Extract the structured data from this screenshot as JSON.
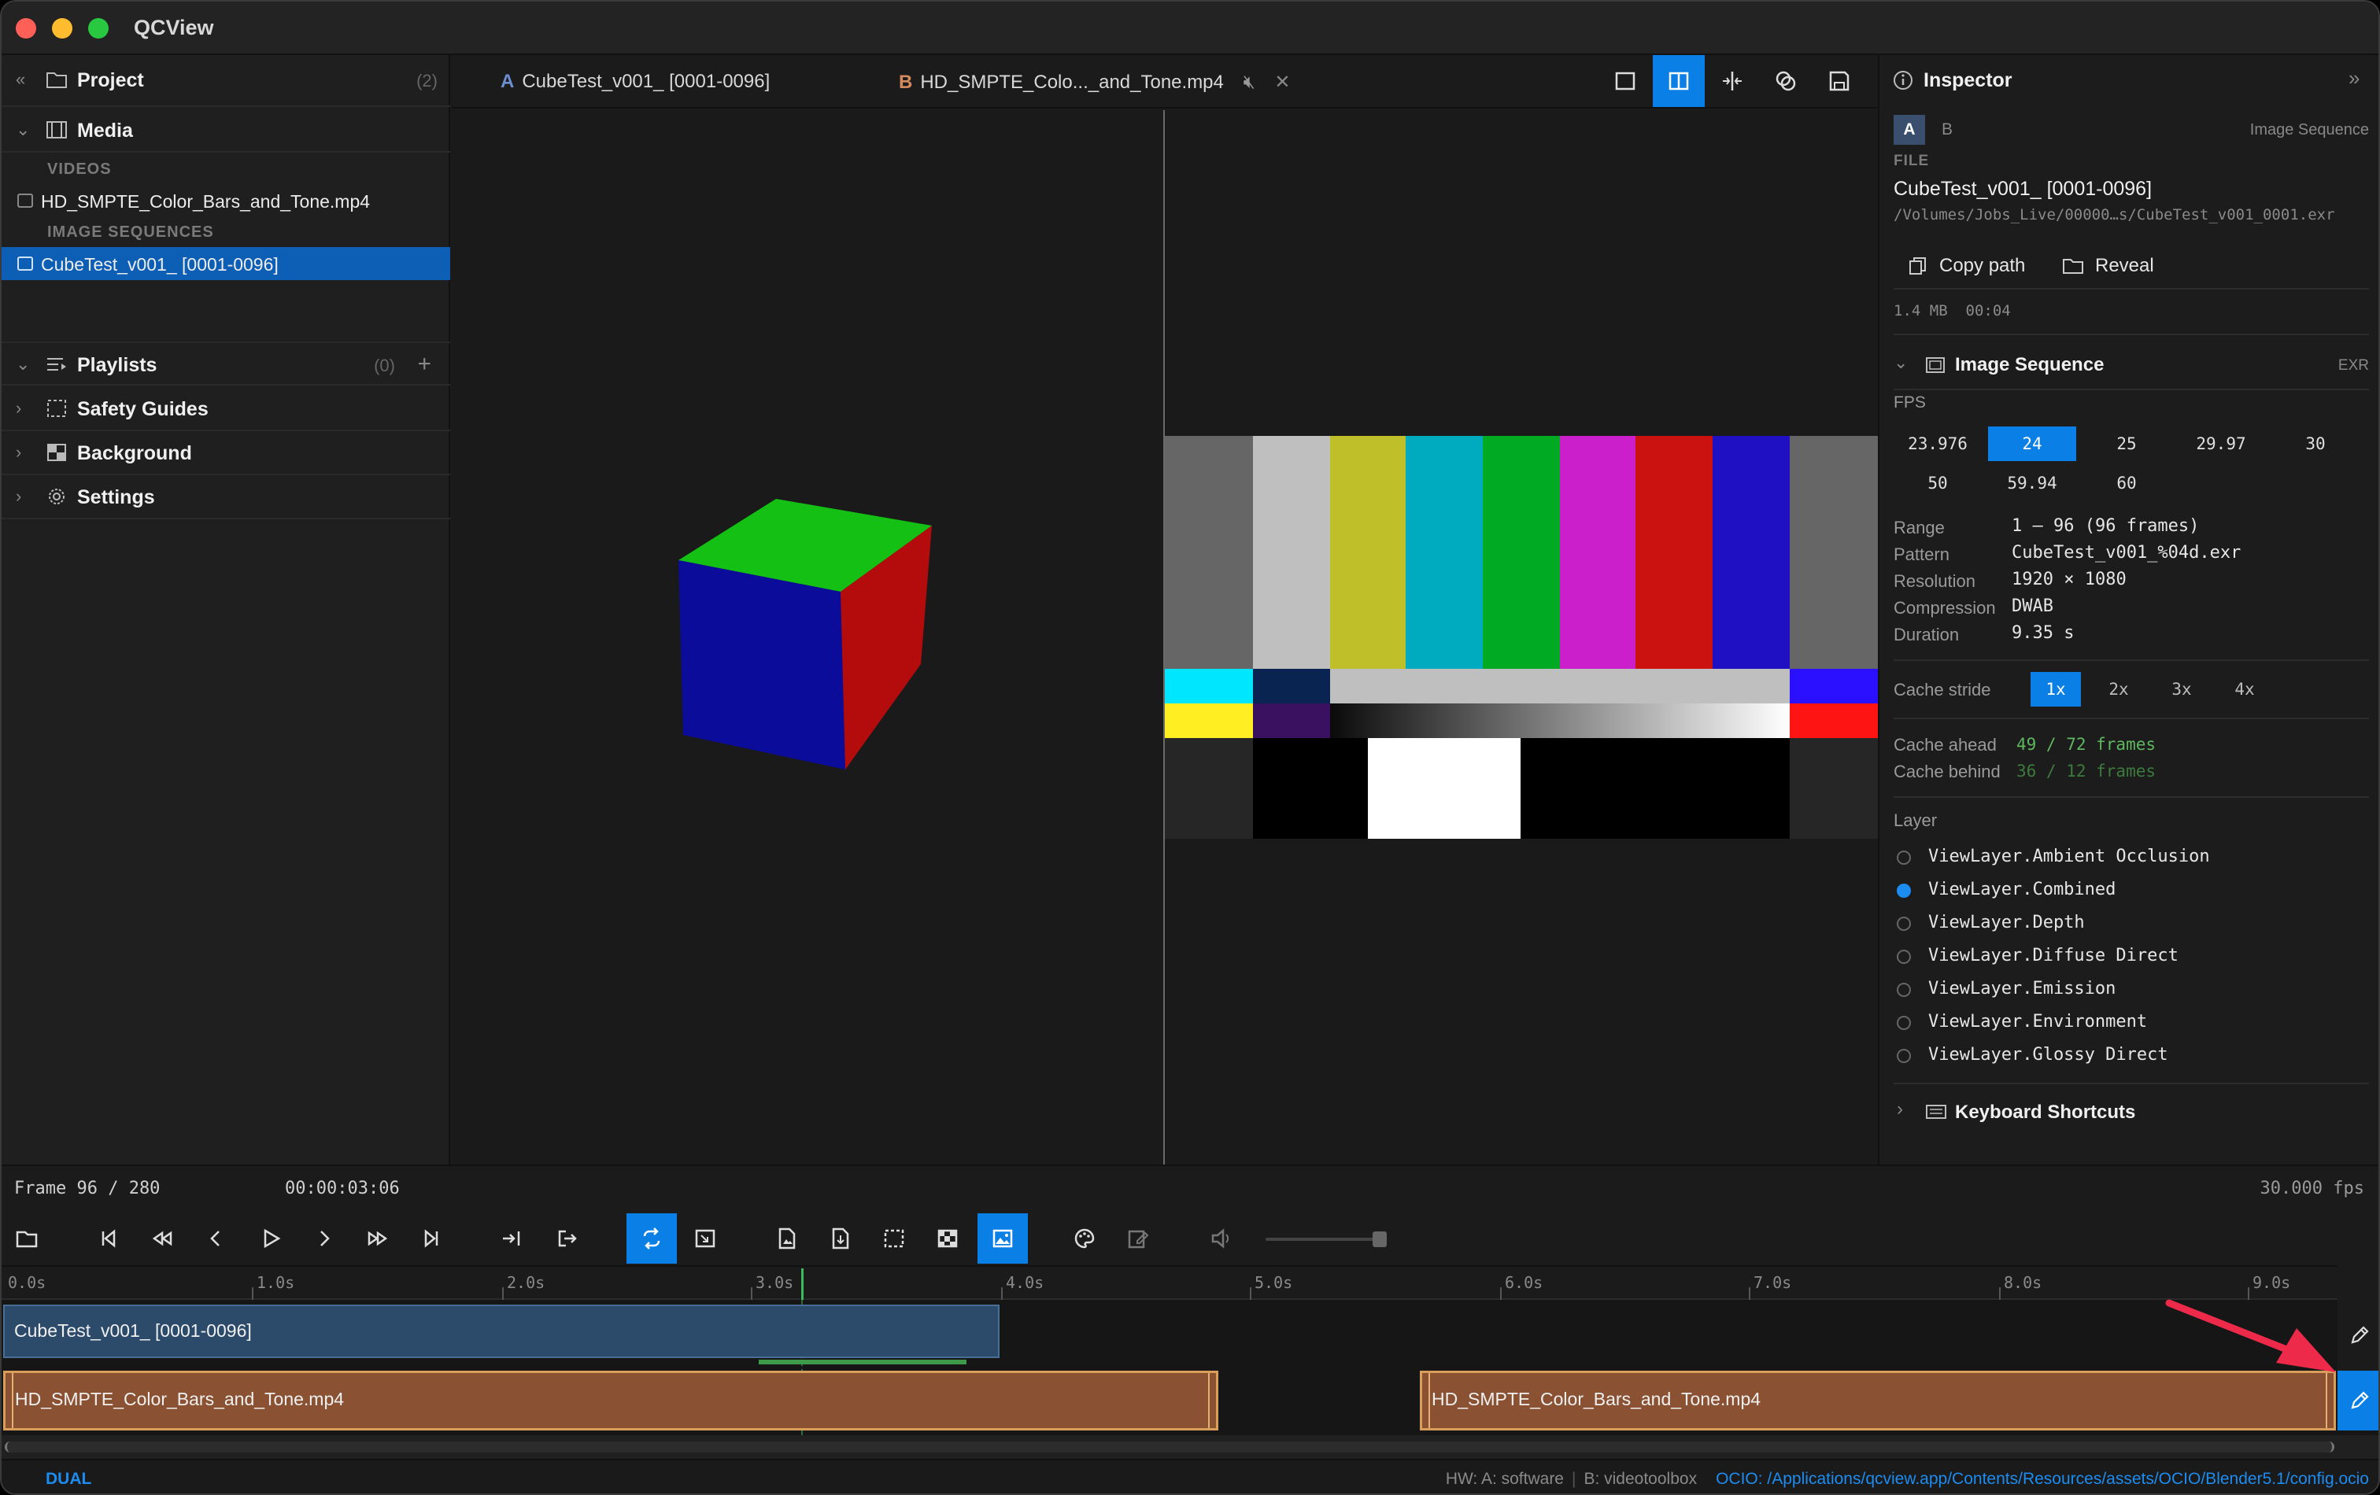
{
  "app": {
    "title": "QCView"
  },
  "left_panel": {
    "project": {
      "label": "Project",
      "count": "(2)"
    },
    "media": {
      "label": "Media"
    },
    "videos_header": "VIDEOS",
    "videos": [
      {
        "name": "HD_SMPTE_Color_Bars_and_Tone.mp4"
      }
    ],
    "image_sequences_header": "IMAGE SEQUENCES",
    "image_sequences": [
      {
        "name": "CubeTest_v001_ [0001-0096]",
        "selected": true
      }
    ],
    "playlists": {
      "label": "Playlists",
      "count": "(0)"
    },
    "safety_guides": {
      "label": "Safety Guides"
    },
    "background": {
      "label": "Background"
    },
    "settings": {
      "label": "Settings"
    }
  },
  "tabs": [
    {
      "letter": "A",
      "label": "CubeTest_v001_ [0001-0096]",
      "letter_color": "#6b8fcf"
    },
    {
      "letter": "B",
      "label": "HD_SMPTE_Colo..._and_Tone.mp4",
      "letter_color": "#d48a5b"
    }
  ],
  "view_modes": [
    {
      "icon": "single-view-icon",
      "active": false
    },
    {
      "icon": "side-by-side-icon",
      "active": true
    },
    {
      "icon": "wipe-icon",
      "active": false
    },
    {
      "icon": "overlay-icon",
      "active": false
    },
    {
      "icon": "save-icon",
      "active": false
    }
  ],
  "inspector": {
    "title": "Inspector",
    "source_tabs": [
      "A",
      "B"
    ],
    "source_type": "Image Sequence",
    "file_label": "FILE",
    "file_name": "CubeTest_v001_ [0001-0096]",
    "file_path": "/Volumes/Jobs_Live/00000…s/CubeTest_v001_0001.exr",
    "copy_path_label": "Copy path",
    "reveal_label": "Reveal",
    "size_info": "1.4 MB  00:04",
    "section_title": "Image Sequence",
    "section_format": "EXR",
    "fps_label": "FPS",
    "fps_options": [
      "23.976",
      "24",
      "25",
      "29.97",
      "30",
      "50",
      "59.94",
      "60"
    ],
    "fps_selected": "24",
    "details": [
      {
        "label": "Range",
        "value": "1 – 96 (96 frames)"
      },
      {
        "label": "Pattern",
        "value": "CubeTest_v001_%04d.exr"
      },
      {
        "label": "Resolution",
        "value": "1920 × 1080"
      },
      {
        "label": "Compression",
        "value": "DWAB"
      },
      {
        "label": "Duration",
        "value": "9.35 s"
      }
    ],
    "cache_stride_label": "Cache stride",
    "cache_stride_options": [
      "1x",
      "2x",
      "3x",
      "4x"
    ],
    "cache_stride_selected": "1x",
    "cache_ahead_label": "Cache ahead",
    "cache_ahead_value": "49 / 72 frames",
    "cache_behind_label": "Cache behind",
    "cache_behind_value": "36 / 12 frames",
    "layer_label": "Layer",
    "layers": [
      {
        "name": "ViewLayer.Ambient Occlusion",
        "selected": false
      },
      {
        "name": "ViewLayer.Combined",
        "selected": true
      },
      {
        "name": "ViewLayer.Depth",
        "selected": false
      },
      {
        "name": "ViewLayer.Diffuse Direct",
        "selected": false
      },
      {
        "name": "ViewLayer.Emission",
        "selected": false
      },
      {
        "name": "ViewLayer.Environment",
        "selected": false
      },
      {
        "name": "ViewLayer.Glossy Direct",
        "selected": false
      }
    ],
    "keyboard_shortcuts_label": "Keyboard Shortcuts"
  },
  "framebar": {
    "frame_text": "Frame 96 / 280",
    "timecode": "00:00:03:06",
    "fps_text": "30.000 fps"
  },
  "ruler": {
    "labels": [
      "0.0s",
      "1.0s",
      "2.0s",
      "3.0s",
      "4.0s",
      "5.0s",
      "6.0s",
      "7.0s",
      "8.0s",
      "9.0s"
    ]
  },
  "tracks": {
    "a_clip": "CubeTest_v001_ [0001-0096]",
    "b_clip_1": "HD_SMPTE_Color_Bars_and_Tone.mp4",
    "b_clip_2": "HD_SMPTE_Color_Bars_and_Tone.mp4"
  },
  "status": {
    "mode": "DUAL",
    "hw": "HW: A: software",
    "b_decoder": "B: videotoolbox",
    "ocio": "OCIO: /Applications/qcview.app/Contents/Resources/assets/OCIO/Blender5.1/config.ocio"
  },
  "colors": {
    "accent": "#0a7fe6",
    "cache_green": "#5fb85f",
    "cache_green_dim": "#3d7a3d",
    "clip_a": "#2c4a6a",
    "clip_b": "#8a5233",
    "annotation_arrow": "#ee2a4a"
  }
}
